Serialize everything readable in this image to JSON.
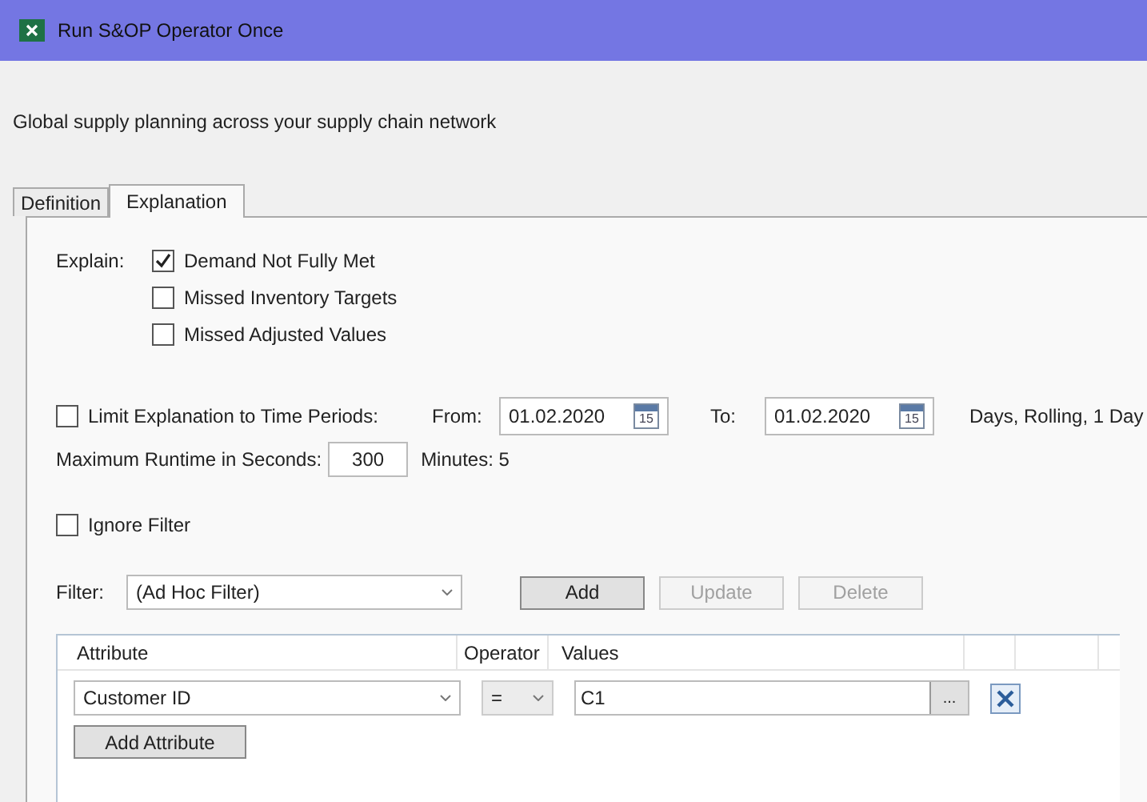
{
  "window": {
    "title": "Run S&OP Operator Once"
  },
  "description": "Global supply planning across your supply chain network",
  "tabs": [
    {
      "label": "Definition",
      "selected": false
    },
    {
      "label": "Explanation",
      "selected": true
    }
  ],
  "explain": {
    "label": "Explain:",
    "options": [
      {
        "label": "Demand Not Fully Met",
        "checked": true
      },
      {
        "label": "Missed Inventory Targets",
        "checked": false
      },
      {
        "label": "Missed Adjusted Values",
        "checked": false
      }
    ]
  },
  "time_limit": {
    "label": "Limit Explanation to Time Periods:",
    "checked": false,
    "from_label": "From:",
    "from_value": "01.02.2020",
    "to_label": "To:",
    "to_value": "01.02.2020",
    "from_calendar_day": "15",
    "to_calendar_day": "15",
    "period": "Days, Rolling, 1 Day"
  },
  "runtime": {
    "label": "Maximum Runtime in Seconds:",
    "value": "300",
    "minutes": "Minutes: 5"
  },
  "ignore_filter": {
    "label": "Ignore Filter",
    "checked": false
  },
  "filter": {
    "label": "Filter:",
    "value": "(Ad Hoc Filter)",
    "buttons": [
      {
        "label": "Add",
        "disabled": false
      },
      {
        "label": "Update",
        "disabled": true
      },
      {
        "label": "Delete",
        "disabled": true
      }
    ]
  },
  "attributes_table": {
    "columns": [
      "Attribute",
      "Operator",
      "Values"
    ],
    "rows": [
      {
        "attribute": "Customer ID",
        "operator": "=",
        "value": "C1",
        "browse": "..."
      }
    ],
    "add_button": "Add Attribute"
  }
}
